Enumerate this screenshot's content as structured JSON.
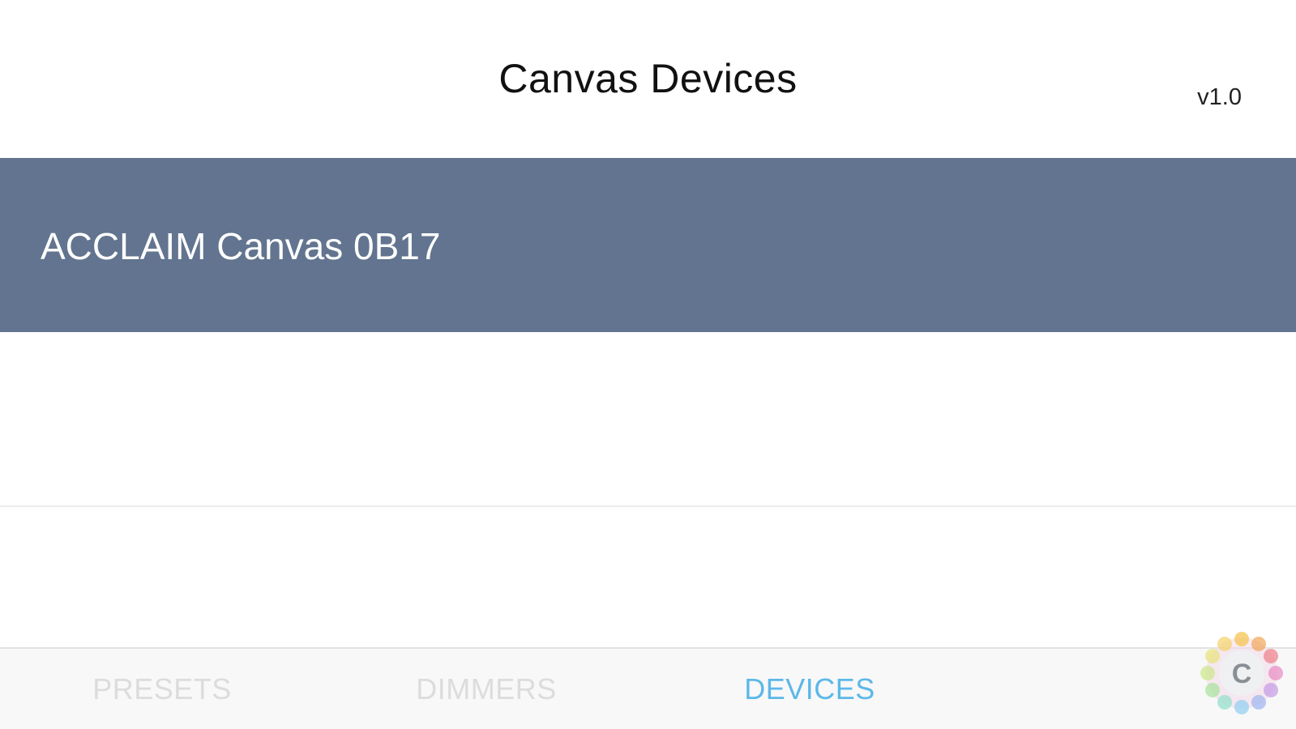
{
  "header": {
    "title": "Canvas Devices",
    "version": "v1.0"
  },
  "devices": [
    {
      "name": "ACCLAIM Canvas 0B17",
      "selected": true
    }
  ],
  "tabs": [
    {
      "label": "PRESETS",
      "active": false,
      "color": "#dcdcdc"
    },
    {
      "label": "DIMMERS",
      "active": false,
      "color": "#dcdcdc"
    },
    {
      "label": "DEVICES",
      "active": true,
      "color": "#5cb8e8"
    }
  ],
  "colors": {
    "selected_row": "#62748f",
    "accent": "#5cb8e8",
    "inactive_tab": "#dcdcdc"
  },
  "logo": {
    "icon": "canvas-logo-icon",
    "letter": "C"
  }
}
